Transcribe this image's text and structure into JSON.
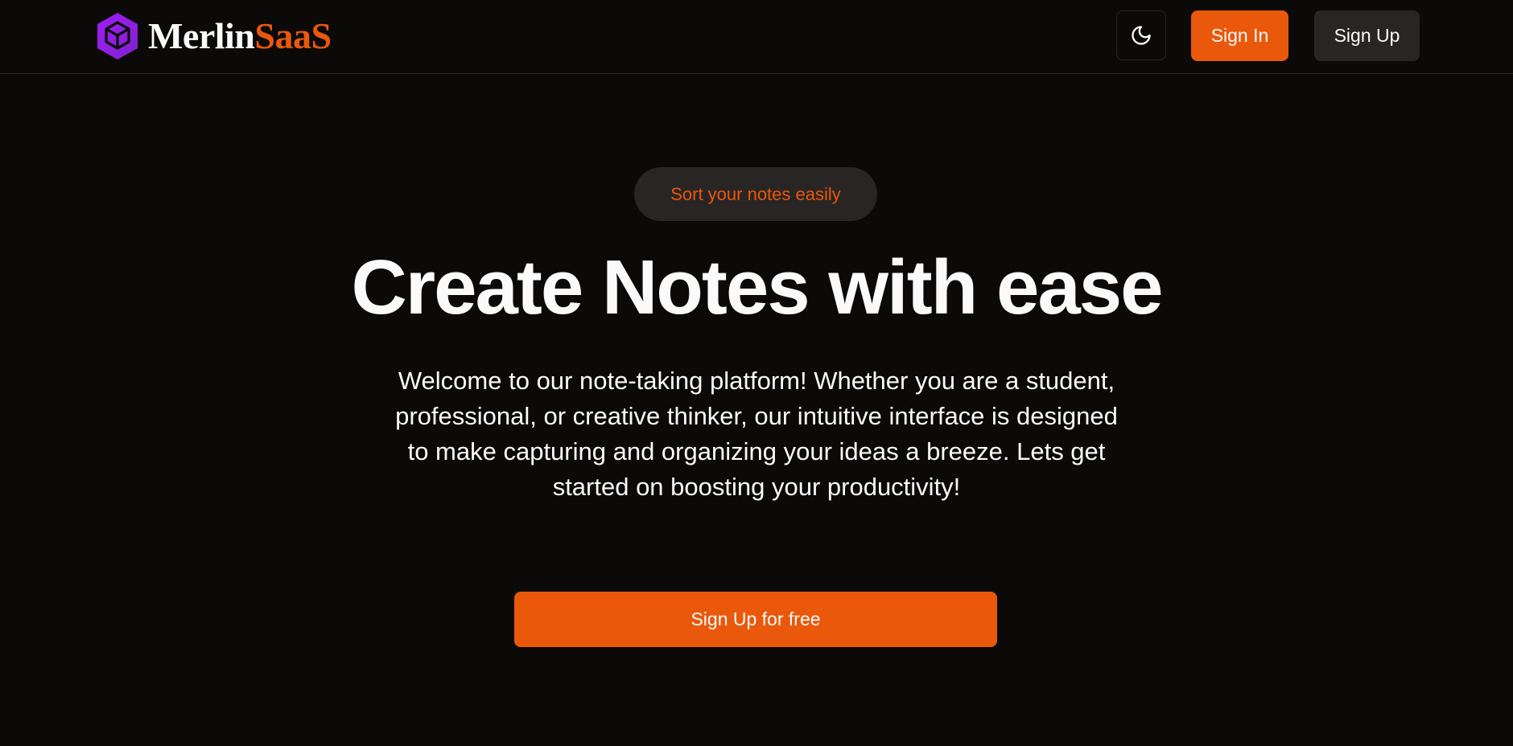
{
  "brand": {
    "name_part1": "Merlin",
    "name_part2": "SaaS",
    "logo_icon": "hexagon-cube-icon",
    "logo_color": "#9d1ff2"
  },
  "header": {
    "theme_toggle_icon": "moon-icon",
    "sign_in_label": "Sign In",
    "sign_up_label": "Sign Up"
  },
  "hero": {
    "badge": "Sort your notes easily",
    "title": "Create Notes with ease",
    "description": "Welcome to our note-taking platform! Whether you are a student, professional, or creative thinker, our intuitive interface is designed to make capturing and organizing your ideas a breeze. Lets get started on boosting your productivity!",
    "cta_label": "Sign Up for free"
  },
  "colors": {
    "background": "#0c0a09",
    "accent": "#ea580c",
    "muted": "#292524",
    "text": "#fafafa"
  }
}
